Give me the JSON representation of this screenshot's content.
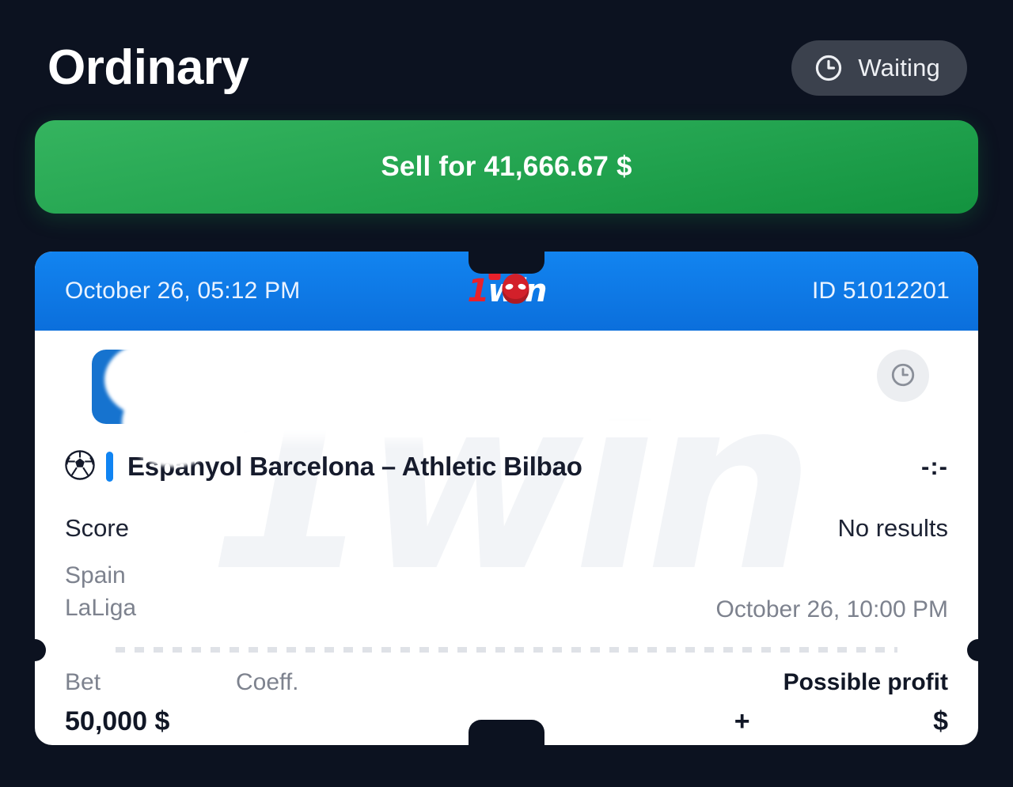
{
  "header": {
    "title": "Ordinary",
    "status": {
      "label": "Waiting",
      "icon": "clock-icon"
    }
  },
  "sell_button": {
    "label": "Sell for 41,666.67 $",
    "color": "#22a34f"
  },
  "ticket": {
    "head": {
      "date": "October 26, 05:12 PM",
      "bet_id": "ID 51012201",
      "brand": {
        "prefix": "1",
        "suffix": "win"
      },
      "color": "#0b6fdc"
    },
    "watermark": "1win",
    "event": {
      "sport_icon": "soccer-ball-icon",
      "status_icon": "clock-icon",
      "name": "Espanyol Barcelona – Athletic Bilbao",
      "score_display": "-:-",
      "score_label": "Score",
      "score_value": "No results",
      "league_country": "Spain",
      "league_name": "LaLiga",
      "start_time": "October 26, 10:00 PM"
    },
    "footer": {
      "bet_label": "Bet",
      "bet_value": "50,000 $",
      "coeff_label": "Coeff.",
      "coeff_value": "+",
      "profit_label": "Possible profit",
      "profit_value": "$"
    }
  }
}
